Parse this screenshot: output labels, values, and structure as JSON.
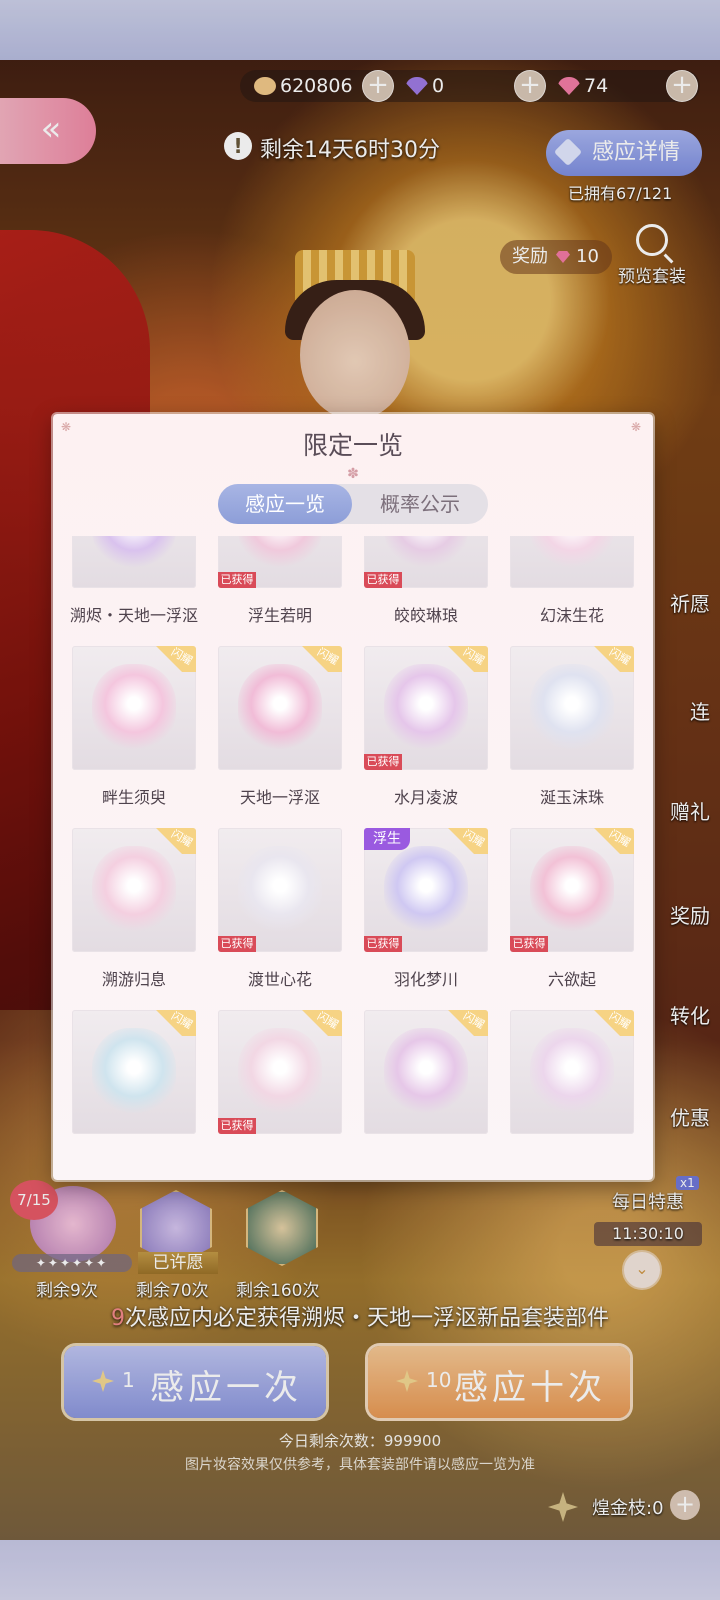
{
  "currency": {
    "coins": "620806",
    "diamonds": "0",
    "gems": "74"
  },
  "header": {
    "timer": "剩余14天6时30分",
    "detail_button": "感应详情",
    "owned": "已拥有67/121",
    "reward_label": "奖励",
    "reward_value": "10",
    "preview": "预览套装"
  },
  "side_menu": [
    "祈愿",
    "连",
    "赠礼",
    "奖励",
    "转化",
    "优惠"
  ],
  "modal": {
    "title": "限定一览",
    "tabs": [
      "感应一览",
      "概率公示"
    ],
    "badge_flash": "闪耀",
    "badge_got": "已获得",
    "badge_fu": "浮生",
    "items": [
      {
        "name": "溯烬・天地一浮沤",
        "got": false,
        "flash": false
      },
      {
        "name": "浮生若明",
        "got": true,
        "flash": false
      },
      {
        "name": "皎皎琳琅",
        "got": true,
        "flash": false
      },
      {
        "name": "幻沫生花",
        "got": false,
        "flash": false
      },
      {
        "name": "畔生须臾",
        "got": false,
        "flash": true
      },
      {
        "name": "天地一浮沤",
        "got": false,
        "flash": true
      },
      {
        "name": "水月凌波",
        "got": true,
        "flash": true
      },
      {
        "name": "涎玉沫珠",
        "got": false,
        "flash": true
      },
      {
        "name": "溯游归息",
        "got": false,
        "flash": true
      },
      {
        "name": "渡世心花",
        "got": true,
        "flash": false
      },
      {
        "name": "羽化梦川",
        "got": true,
        "flash": true,
        "fu": true
      },
      {
        "name": "六欲起",
        "got": true,
        "flash": true
      },
      {
        "name": "",
        "got": false,
        "flash": true
      },
      {
        "name": "",
        "got": true,
        "flash": true
      },
      {
        "name": "",
        "got": false,
        "flash": true
      },
      {
        "name": "",
        "got": false,
        "flash": true
      }
    ]
  },
  "gacha": {
    "progress": "7/15",
    "stars": "✦✦✦✦✦✦",
    "wished": "已许愿",
    "remain": [
      "剩余9次",
      "剩余70次",
      "剩余160次"
    ],
    "daily_title": "每日特惠",
    "daily_time": "11:30:10",
    "x1": "x1",
    "guarantee_num": "9",
    "guarantee_text": "次感应内必定获得溯烬・天地一浮沤新品套装部件",
    "draw_one_cost": "1",
    "draw_one": "感应一次",
    "draw_ten_cost": "10",
    "draw_ten": "感应十次",
    "today": "今日剩余次数：999900",
    "note": "图片妆容效果仅供参考，具体套装部件请以感应一览为准",
    "branch": "煌金枝:0"
  },
  "colors": {
    "accent_blue": "#8d9ed8",
    "accent_orange": "#e99a55",
    "got_red": "#d94b58"
  }
}
